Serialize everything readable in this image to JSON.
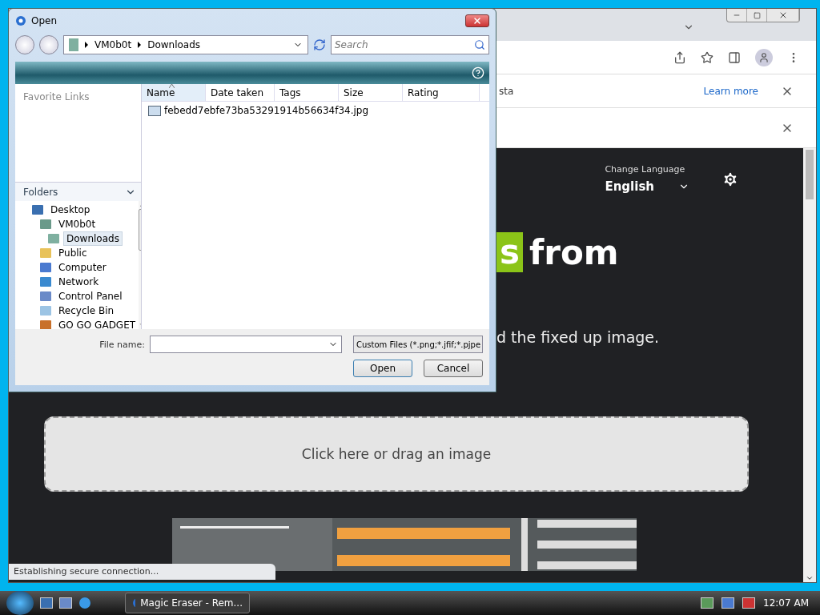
{
  "browser": {
    "infobars": [
      {
        "message": "sta",
        "link": "Learn more"
      }
    ],
    "page": {
      "language_label": "Change Language",
      "language": "English",
      "headline_highlight": "s",
      "headline_rest": "from",
      "subtitle": "d the fixed up image.",
      "dropzone": "Click here or drag an image"
    },
    "status": "Establishing secure connection..."
  },
  "dialog": {
    "title": "Open",
    "path": [
      "VM0b0t",
      "Downloads"
    ],
    "search_placeholder": "Search",
    "favorite_links": "Favorite Links",
    "folders_label": "Folders",
    "tree": [
      {
        "label": "Desktop",
        "kind": "desktop",
        "selected": false,
        "children": [
          {
            "label": "VM0b0t",
            "kind": "user",
            "selected": false,
            "children": [
              {
                "label": "Downloads",
                "kind": "library",
                "selected": true
              }
            ]
          },
          {
            "label": "Public",
            "kind": "folder",
            "selected": false
          },
          {
            "label": "Computer",
            "kind": "computer",
            "selected": false
          },
          {
            "label": "Network",
            "kind": "network",
            "selected": false
          },
          {
            "label": "Control Panel",
            "kind": "control",
            "selected": false
          },
          {
            "label": "Recycle Bin",
            "kind": "recycle",
            "selected": false
          },
          {
            "label": "GO GO GADGET",
            "kind": "gadget",
            "selected": false
          }
        ]
      }
    ],
    "columns": [
      {
        "label": "Name",
        "sorted": true
      },
      {
        "label": "Date taken",
        "sorted": false
      },
      {
        "label": "Tags",
        "sorted": false
      },
      {
        "label": "Size",
        "sorted": false
      },
      {
        "label": "Rating",
        "sorted": false
      }
    ],
    "files": [
      {
        "name": "febedd7ebfe73ba53291914b56634f34.jpg"
      }
    ],
    "file_name_label": "File name:",
    "filter": "Custom Files (*.png;*.jfif;*.pjpe",
    "buttons": [
      {
        "label": "Open",
        "default": true
      },
      {
        "label": "Cancel",
        "default": false
      }
    ]
  },
  "taskbar": {
    "tasks": [
      {
        "label": "Magic Eraser - Rem...",
        "selected": true
      }
    ],
    "clock": "12:07 AM"
  }
}
